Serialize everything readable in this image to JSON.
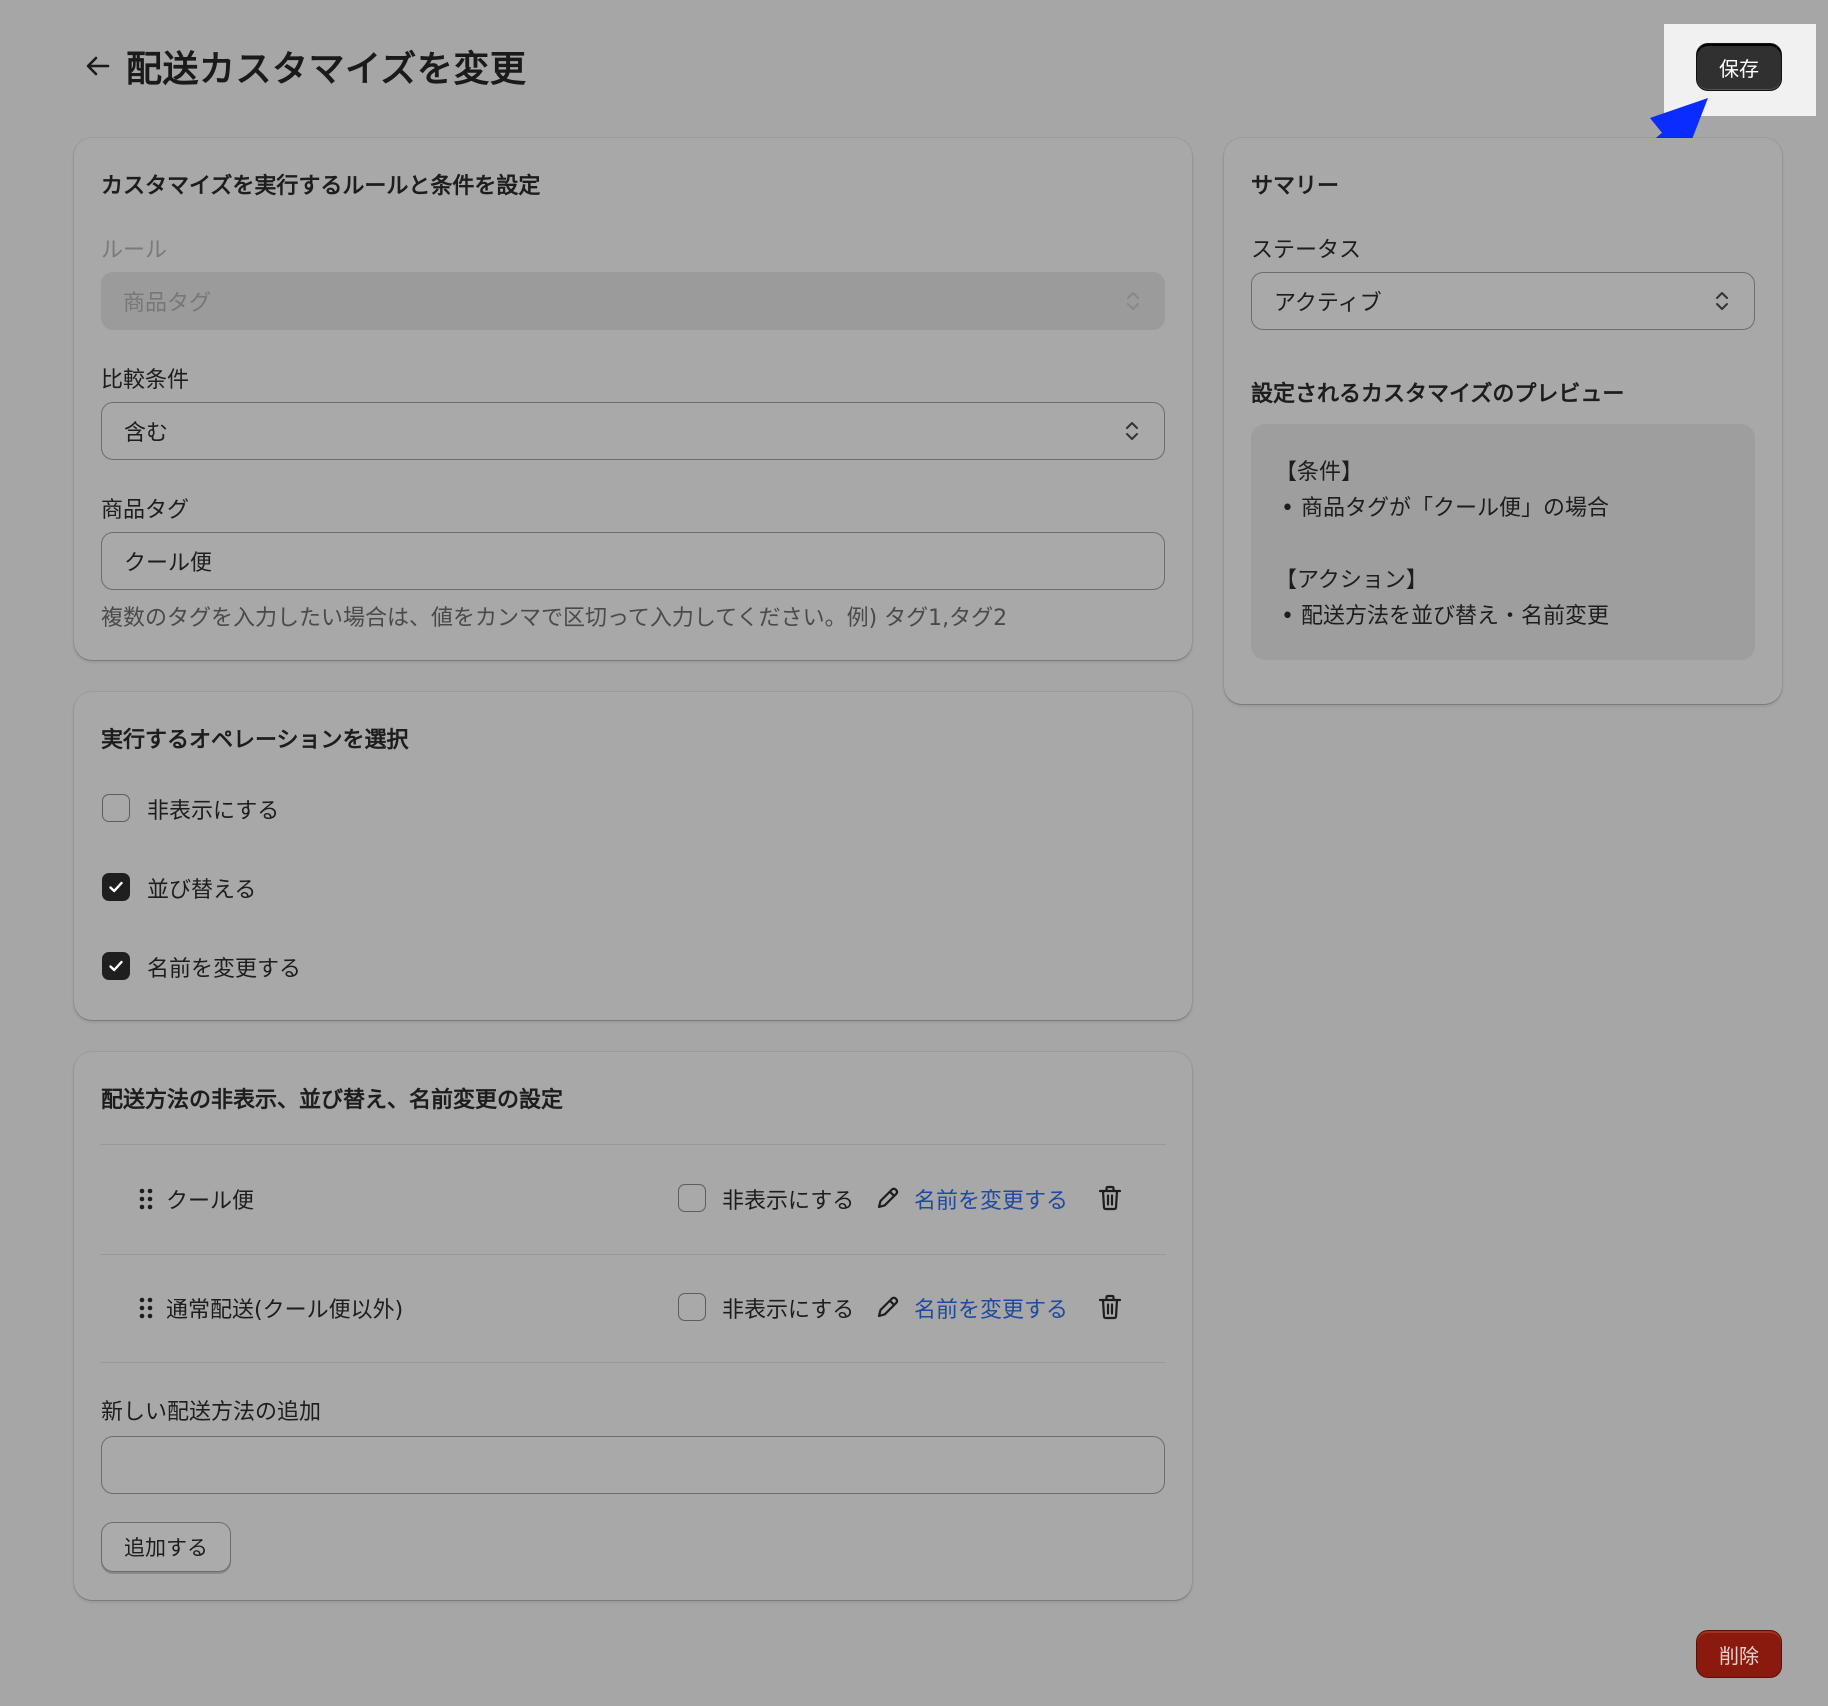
{
  "header": {
    "title": "配送カスタマイズを変更",
    "save_label": "保存"
  },
  "rules_card": {
    "title": "カスタマイズを実行するルールと条件を設定",
    "rule_label": "ルール",
    "rule_value": "商品タグ",
    "comparison_label": "比較条件",
    "comparison_value": "含む",
    "tag_label": "商品タグ",
    "tag_value": "クール便",
    "help_text": "複数のタグを入力したい場合は、値をカンマで区切って入力してください。例) タグ1,タグ2"
  },
  "operations_card": {
    "title": "実行するオペレーションを選択",
    "options": [
      {
        "label": "非表示にする",
        "checked": false
      },
      {
        "label": "並び替える",
        "checked": true
      },
      {
        "label": "名前を変更する",
        "checked": true
      }
    ]
  },
  "methods_card": {
    "title": "配送方法の非表示、並び替え、名前変更の設定",
    "rows": [
      {
        "name": "クール便",
        "hide_label": "非表示にする",
        "hidden": false,
        "rename_label": "名前を変更する"
      },
      {
        "name": "通常配送(クール便以外)",
        "hide_label": "非表示にする",
        "hidden": false,
        "rename_label": "名前を変更する"
      }
    ],
    "new_method_label": "新しい配送方法の追加",
    "new_method_value": "",
    "add_label": "追加する"
  },
  "summary_card": {
    "title": "サマリー",
    "status_label": "ステータス",
    "status_value": "アクティブ",
    "preview_title": "設定されるカスタマイズのプレビュー",
    "preview": {
      "condition_heading": "【条件】",
      "condition_item": "• 商品タグが「クール便」の場合",
      "action_heading": "【アクション】",
      "action_item": "• 配送方法を並び替え・名前変更"
    }
  },
  "footer": {
    "delete_label": "削除"
  },
  "colors": {
    "annotation_arrow": "#0a2cff",
    "link": "#1f4a9e",
    "delete": "#8a1a0e",
    "primary": "#303030"
  }
}
